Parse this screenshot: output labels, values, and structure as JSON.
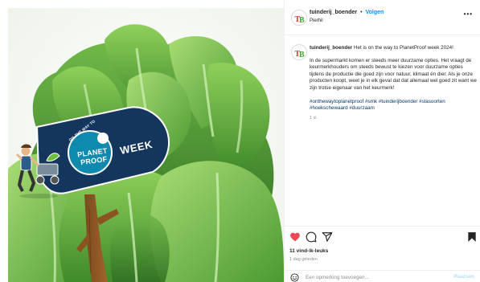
{
  "post": {
    "username": "tuinderij_boender",
    "follow_label": "Volgen",
    "separator": "•",
    "location": "Pierhil",
    "more_label": "•••",
    "avatar_logo": "TB",
    "caption": {
      "headline": "Het is on the way to PlanetProof week 2024!",
      "paragraph": "In de supermarkt komen er steeds meer duurzame opties. Het vraagt de keurmerkhouders om steeds bewust te kiezen voor duurzame opties tijdens de productie die goed zijn voor natuur, klimaat én dier. Als je onze producten koopt, weet je in elk geval dat dat allemaal wel goed zit want we zijn trotse eigenaar van het keurmerk!",
      "hashtags": "#onthewaytoplanetproof #smk #tuinderijboender #slasoorten #hoekschewaard #duurzaam",
      "time": "1 d."
    },
    "likes": "11 vind-ik-leuks",
    "posted_when": "1 dag geleden",
    "comment_placeholder": "Een opmerking toevoegen...",
    "post_button": "Plaatsen"
  },
  "image": {
    "sign_small_text": "ON THE WAY TO",
    "sign_brand_line1": "PLANET",
    "sign_brand_line2": "PROOF",
    "sign_week": "WEEK"
  },
  "colors": {
    "sign_navy": "#14355c",
    "sign_badge": "#0e8aae",
    "lettuce": "#5fa83a",
    "like_red": "#ed4956",
    "link_blue": "#0095f6",
    "hashtag": "#00376b"
  }
}
